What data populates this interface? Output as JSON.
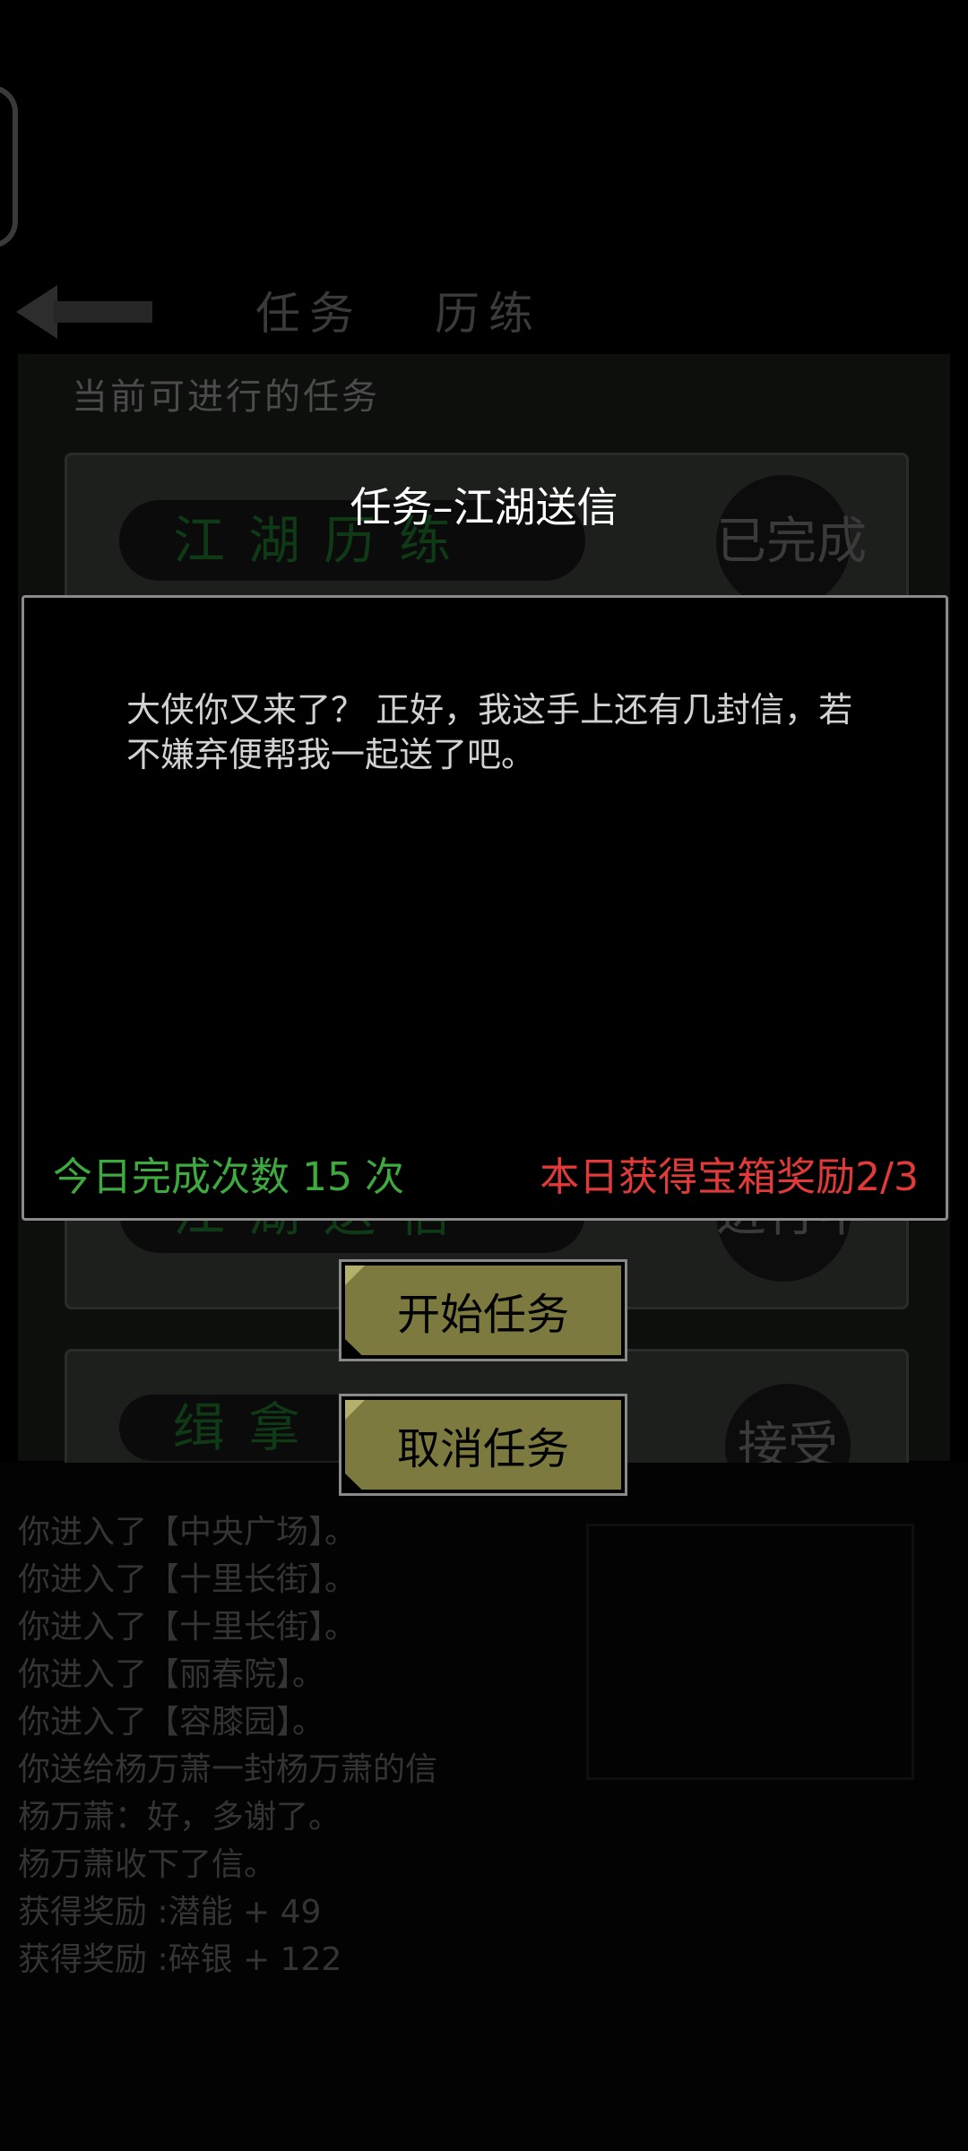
{
  "nav": {
    "tab_quest": "任务",
    "tab_training": "历练"
  },
  "current_label": "当前可进行的任务",
  "quests": [
    {
      "name": "江湖历练",
      "status": "已完成"
    },
    {
      "name": "",
      "status": ""
    },
    {
      "name": "",
      "status": ""
    },
    {
      "name": "江湖送信",
      "status": "进行中"
    },
    {
      "name": "缉拿",
      "status": "接受"
    }
  ],
  "dialog": {
    "title": "任务–江湖送信",
    "text": "大侠你又来了？ 正好，我这手上还有几封信，若不嫌弃便帮我一起送了吧。",
    "count": "今日完成次数 15 次",
    "reward": "本日获得宝箱奖励2/3",
    "start_button": "开始任务",
    "cancel_button": "取消任务"
  },
  "log": [
    "你进入了【中央广场】。",
    "你进入了【十里长街】。",
    "你进入了【十里长街】。",
    "你进入了【丽春院】。",
    "你进入了【容膝园】。",
    "你送给杨万萧一封杨万萧的信",
    "杨万萧：好，多谢了。",
    "杨万萧收下了信。",
    "获得奖励 :潜能 + 49",
    "获得奖励 :碎银 + 122"
  ],
  "colors": {
    "count": "#3ea93e",
    "reward": "#e23a3a",
    "button": "#7d7a40"
  }
}
